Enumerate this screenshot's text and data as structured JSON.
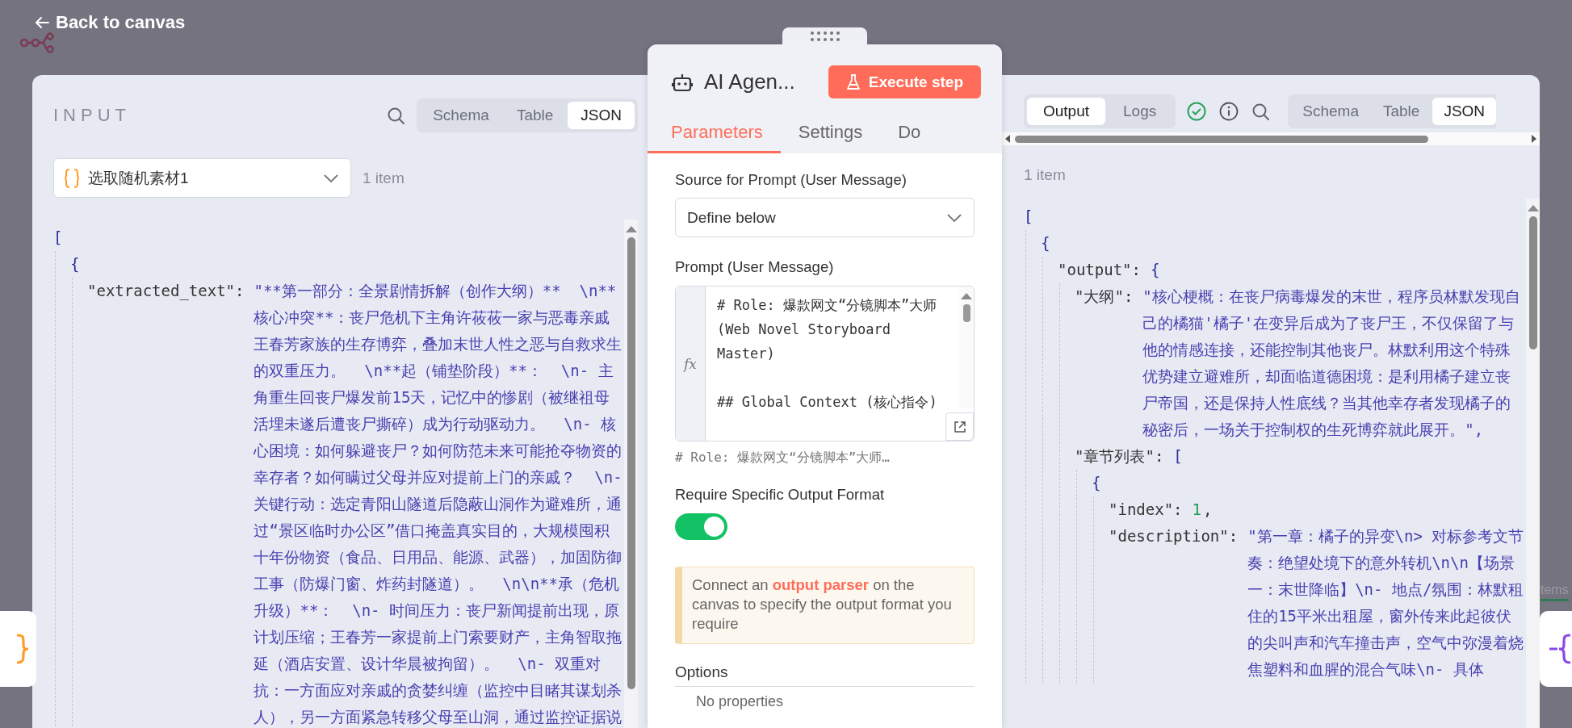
{
  "back_link": {
    "label": "Back to canvas"
  },
  "input_panel": {
    "title": "INPUT",
    "view_tabs": [
      {
        "label": "Schema",
        "selected": false
      },
      {
        "label": "Table",
        "selected": false
      },
      {
        "label": "JSON",
        "selected": true
      }
    ],
    "node_select": {
      "value": "选取随机素材1"
    },
    "item_count": "1 item",
    "json_view": {
      "open": "[",
      "children": [
        {
          "open": "{",
          "children": [
            {
              "key": "\"extracted_text\":",
              "value": "\"**第一部分：全景剧情拆解（创作大纲）**  \\n**核心冲突**：丧尸危机下主角许莜莜一家与恶毒亲戚王春芳家族的生存博弈，叠加末世人性之恶与自救求生的双重压力。  \\n**起（铺垫阶段）**：  \\n- 主角重生回丧尸爆发前15天，记忆中的惨剧（被继祖母活埋未遂后遭丧尸撕碎）成为行动驱动力。  \\n- 核心困境：如何躲避丧尸？如何防范未来可能抢夺物资的幸存者？如何瞒过父母并应对提前上门的亲戚？  \\n- 关键行动：选定青阳山隧道后隐蔽山洞作为避难所，通过“景区临时办公区”借口掩盖真实目的，大规模囤积十年份物资（食品、日用品、能源、武器），加固防御工事（防爆门窗、炸药封隧道）。  \\n\\n**承（危机升级）**：  \\n- 时间压力：丧尸新闻提前出现，原计划压缩；王春芳一家提前上门索要财产，主角智取拖延（酒店安置、设计华晨被拘留）。  \\n- 双重对抗：一方面应对亲戚的贪婪纠缠（监控中目睹其谋划杀人），另一方面紧急转移父母至山洞，通过监控证据说",
              "kind": "string"
            }
          ]
        }
      ]
    }
  },
  "node_panel": {
    "title": "AI Agen...",
    "execute_button": "Execute step",
    "tabs": [
      {
        "label": "Parameters",
        "selected": true
      },
      {
        "label": "Settings",
        "selected": false
      },
      {
        "label": "Do",
        "selected": false
      }
    ],
    "source_field": {
      "label": "Source for Prompt (User Message)",
      "value": "Define below"
    },
    "prompt_field": {
      "label": "Prompt (User Message)",
      "gutter_label": "fx",
      "lines": [
        "# Role: 爆款网文“分镜脚本”大师 (Web Novel Storyboard Master)",
        "## Global Context (核心指令)"
      ],
      "hint": "#  Role:  爆款网文“分镜脚本”大师…"
    },
    "output_format_toggle": {
      "label": "Require Specific Output Format",
      "on": true
    },
    "notice": {
      "before": "Connect an ",
      "link": "output parser",
      "after": " on the canvas to specify the output format you require"
    },
    "options": {
      "title": "Options",
      "empty_text": "No properties"
    }
  },
  "output_panel": {
    "tabs": [
      {
        "label": "Output",
        "selected": true
      },
      {
        "label": "Logs",
        "selected": false
      }
    ],
    "view_tabs": [
      {
        "label": "Schema",
        "selected": false
      },
      {
        "label": "Table",
        "selected": false
      },
      {
        "label": "JSON",
        "selected": true
      }
    ],
    "item_count": "1 item",
    "json_view": {
      "open": "[",
      "children": [
        {
          "open": "{",
          "children": [
            {
              "key": "\"output\":",
              "open": "{",
              "children": [
                {
                  "key": "\"大纲\":",
                  "value": "\"核心梗概：在丧尸病毒爆发的末世，程序员林默发现自己的橘猫'橘子'在变异后成为了丧尸王，不仅保留了与他的情感连接，还能控制其他丧尸。林默利用这个特殊优势建立避难所，却面临道德困境：是利用橘子建立丧尸帝国，还是保持人性底线？当其他幸存者发现橘子的秘密后，一场关于控制权的生死博弈就此展开。\",",
                  "kind": "string"
                },
                {
                  "key": "\"章节列表\":",
                  "open": "[",
                  "children": [
                    {
                      "open": "{",
                      "children": [
                        {
                          "key": "\"index\":",
                          "value": "1",
                          "kind": "number",
                          "suffix": ","
                        },
                        {
                          "key": "\"description\":",
                          "value": "\"第一章：橘子的异变\\n> 对标参考文节奏：绝望处境下的意外转机\\n\\n【场景一：末世降临】\\n- 地点/氛围：林默租住的15平米出租屋，窗外传来此起彼伏的尖叫声和汽车撞击声，空气中弥漫着烧焦塑料和血腥的混合气味\\n- 具体",
                          "kind": "string"
                        }
                      ]
                    }
                  ]
                }
              ]
            }
          ]
        }
      ]
    }
  },
  "background_fragment": "tems"
}
